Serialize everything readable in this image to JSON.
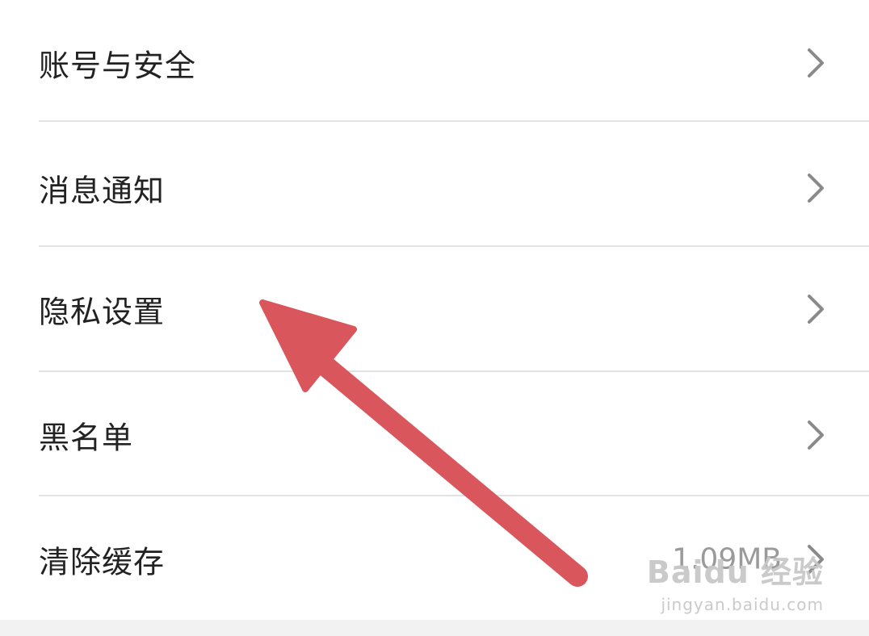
{
  "settings": {
    "items": [
      {
        "label": "账号与安全",
        "value": ""
      },
      {
        "label": "消息通知",
        "value": ""
      },
      {
        "label": "隐私设置",
        "value": ""
      },
      {
        "label": "黑名单",
        "value": ""
      },
      {
        "label": "清除缓存",
        "value": "1.09MB"
      }
    ]
  },
  "icons": {
    "chevron": "chevron-right-icon",
    "annotation": "red-arrow-annotation"
  },
  "colors": {
    "arrow": "#d9575c",
    "chevron": "#8a8a8a",
    "divider": "#e2e2e2",
    "value_text": "#9a9a9a"
  },
  "watermark": {
    "logo": "Baidu 经验",
    "url": "jingyan.baidu.com"
  }
}
